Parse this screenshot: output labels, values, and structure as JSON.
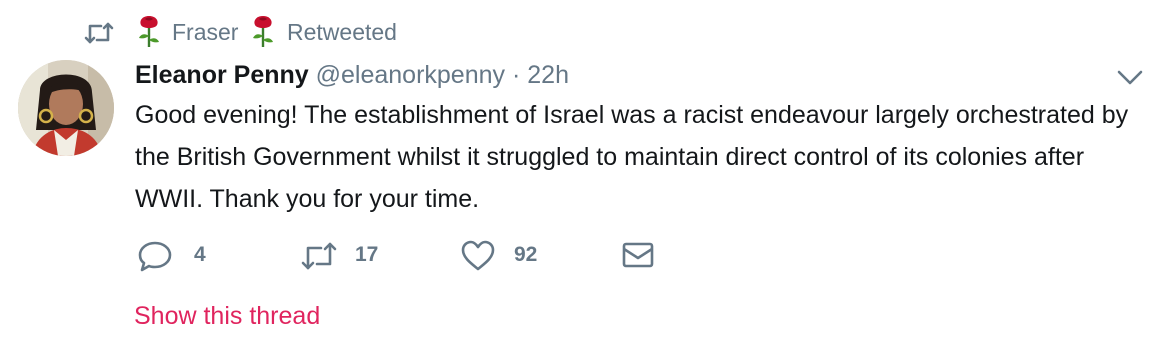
{
  "context": {
    "icon": "retweet-icon",
    "name": "Fraser",
    "label": "Retweeted",
    "emoji": "rose"
  },
  "tweet": {
    "display_name": "Eleanor Penny",
    "handle": "@eleanorkpenny",
    "separator": "·",
    "time": "22h",
    "text": "Good evening! The establishment of Israel was a racist endeavour largely orchestrated by the British Government whilst it struggled to maintain direct control of its colonies after WWII. Thank you for your time."
  },
  "actions": {
    "reply_count": "4",
    "retweet_count": "17",
    "like_count": "92"
  },
  "show_thread": "Show this thread",
  "colors": {
    "text": "#14171a",
    "secondary": "#657786",
    "accent": "#e0245e",
    "rose": "#c8102e"
  }
}
